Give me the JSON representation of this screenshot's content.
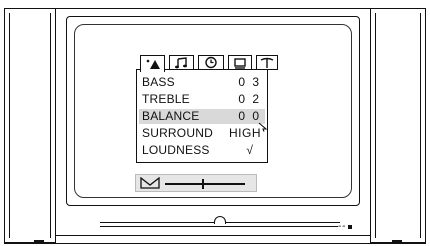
{
  "tabs": [
    {
      "icon": "picture-icon",
      "glyph": "▲",
      "active": true
    },
    {
      "icon": "sound-icon",
      "glyph": "♫",
      "active": false
    },
    {
      "icon": "clock-icon",
      "glyph": "◷",
      "active": false
    },
    {
      "icon": "screen-icon",
      "glyph": "▭",
      "active": false
    },
    {
      "icon": "antenna-icon",
      "glyph": "⟟",
      "active": false
    }
  ],
  "menu": {
    "rows": [
      {
        "label": "BASS",
        "value": "0 3",
        "selected": false
      },
      {
        "label": "TREBLE",
        "value": "0 2",
        "selected": false
      },
      {
        "label": "BALANCE",
        "value": "0 0",
        "selected": true
      },
      {
        "label": "SURROUND",
        "value": "HIGH",
        "selected": false
      },
      {
        "label": "LOUDNESS",
        "value": "√",
        "selected": false
      }
    ]
  },
  "volume": {
    "icon": "speaker-mute-icon",
    "level": 0.47
  }
}
